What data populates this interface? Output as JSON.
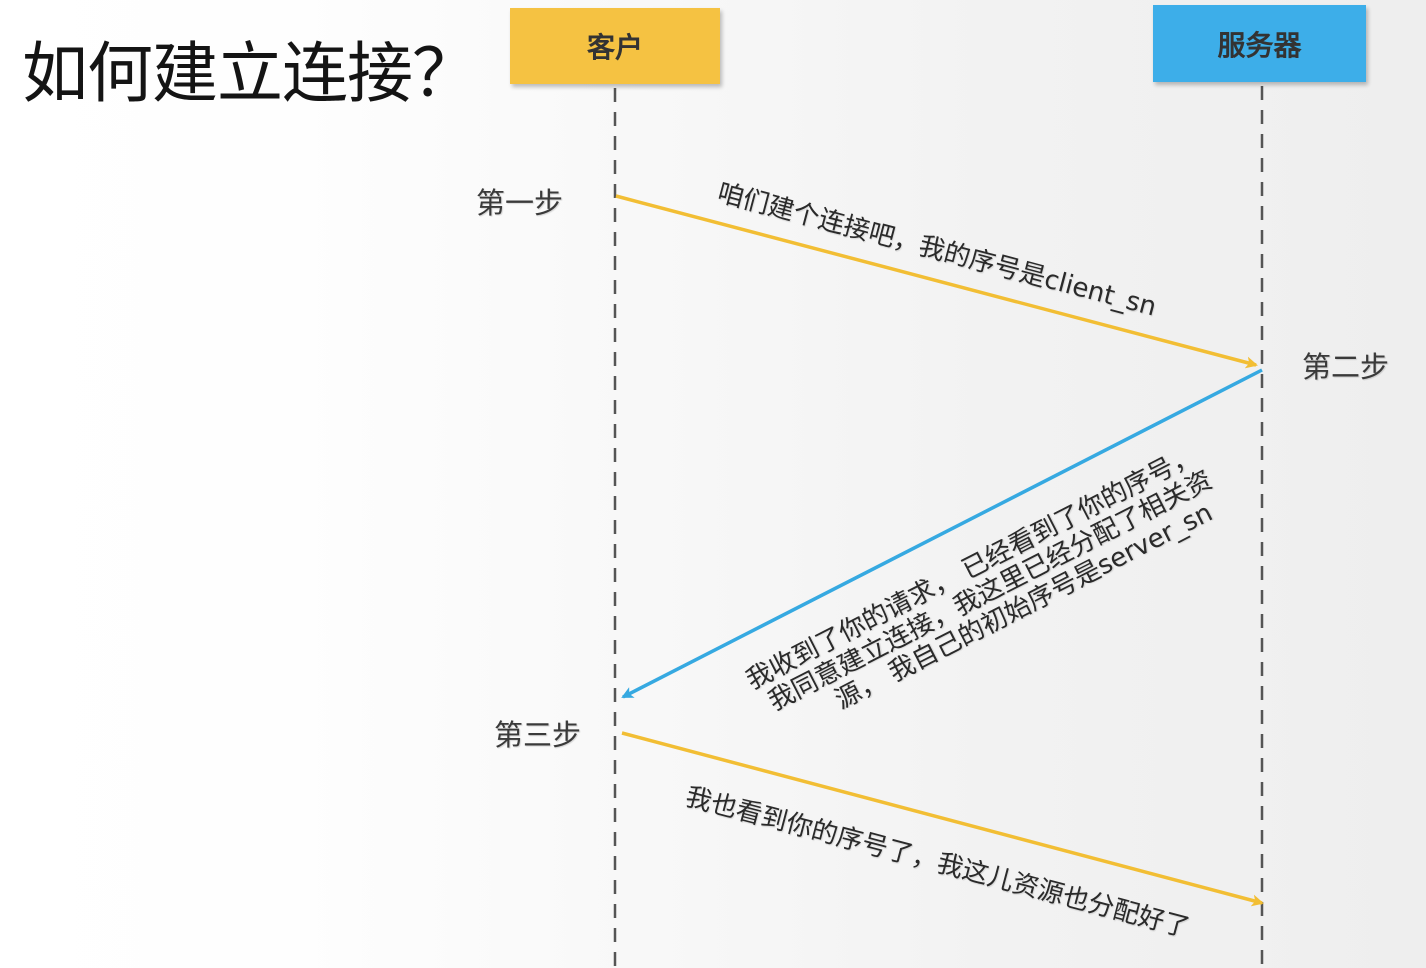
{
  "title": "如何建立连接？",
  "actors": {
    "client": {
      "label": "客户",
      "color": "#F5C242"
    },
    "server": {
      "label": "服务器",
      "color": "#3DAEE9"
    }
  },
  "steps": {
    "step1": "第一步",
    "step2": "第二步",
    "step3": "第三步"
  },
  "messages": {
    "m1": "咱们建个连接吧，我的序号是client_sn",
    "m2": {
      "line1": "我收到了你的请求，  已经看到了你的序号，",
      "line2": "我同意建立连接，我这里已经分配了相关资",
      "line3": "源，  我自己的初始序号是server_sn"
    },
    "m3": "我也看到你的序号了，我这儿资源也分配好了"
  },
  "colors": {
    "request_arrow": "#F2BE34",
    "response_arrow": "#36A9E1",
    "lifeline": "#555555"
  }
}
